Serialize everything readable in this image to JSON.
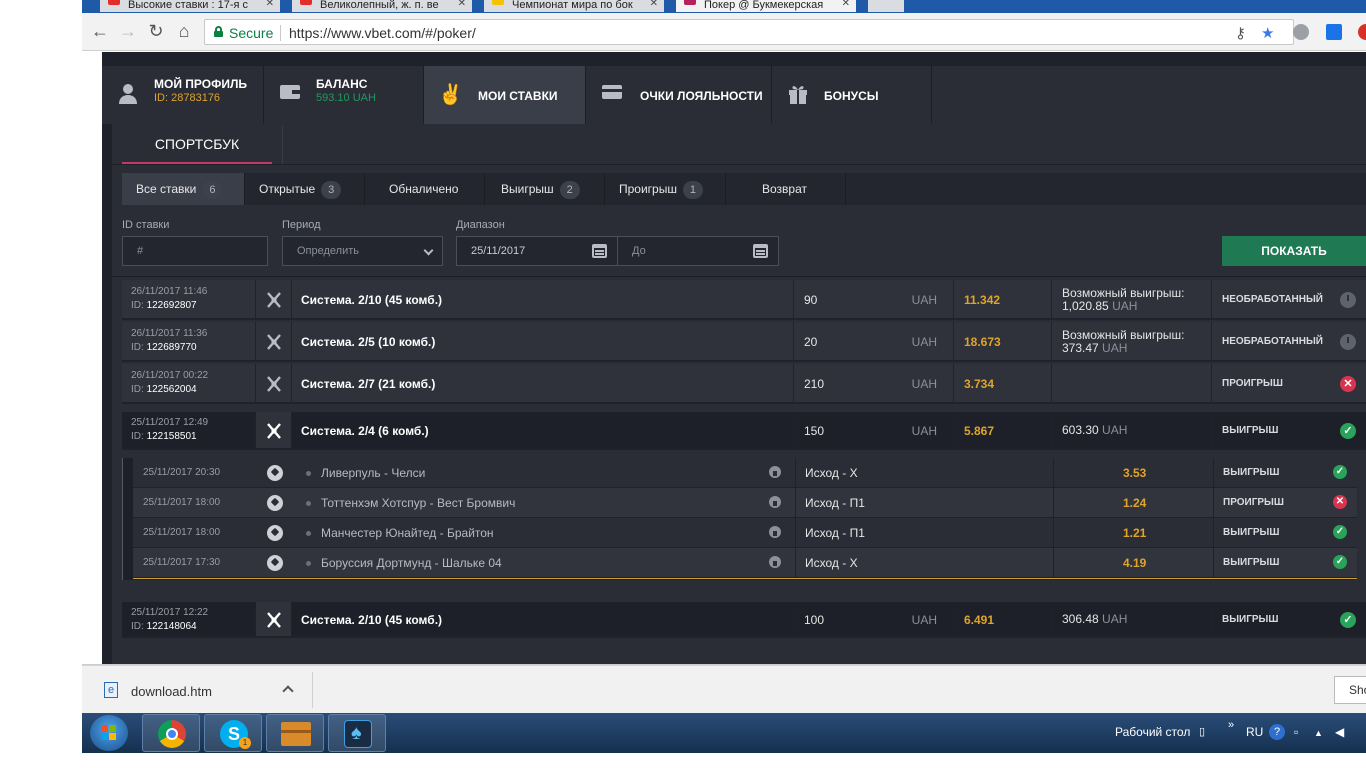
{
  "browser": {
    "tabs": [
      {
        "label": "Высокие ставки : 17-я с",
        "fav_color": "#e52d27"
      },
      {
        "label": "Великолепный, ж. п. ве",
        "fav_color": "#e52d27"
      },
      {
        "label": "Чемпионат мира по бок",
        "fav_color": "#f6c200"
      },
      {
        "label": "Покер @ Букмекерская",
        "fav_color": "#b8205b"
      }
    ],
    "secure_label": "Secure",
    "url": "https://www.vbet.com/#/poker/"
  },
  "account_nav": {
    "profile": {
      "title": "МОЙ ПРОФИЛЬ",
      "sub": "ID: 28783176",
      "sub_color": "#e0a42a"
    },
    "balance": {
      "title": "БАЛАНС",
      "sub": "593.10 UAH",
      "sub_color": "#1f9a5f"
    },
    "bets": {
      "title": "МОИ СТАВКИ"
    },
    "loyalty": {
      "title": "ОЧКИ ЛОЯЛЬНОСТИ"
    },
    "bonuses": {
      "title": "БОНУСЫ"
    }
  },
  "sportsbook_tab": "СПОРТСБУК",
  "filters": [
    {
      "label": "Все ставки",
      "count": "6"
    },
    {
      "label": "Открытые",
      "count": "3"
    },
    {
      "label": "Обналичено",
      "count": ""
    },
    {
      "label": "Выигрыш",
      "count": "2"
    },
    {
      "label": "Проигрыш",
      "count": "1"
    },
    {
      "label": "Возврат",
      "count": ""
    }
  ],
  "search": {
    "id_label": "ID ставки",
    "id_placeholder": "#",
    "period_label": "Период",
    "period_value": "Определить",
    "range_label": "Диапазон",
    "range_from": "25/11/2017",
    "range_to": "До",
    "show_button": "ПОКАЗАТЬ"
  },
  "bets": [
    {
      "date": "26/11/2017 11:46",
      "id": "122692807",
      "type": "Система. 2/10 (45 комб.)",
      "amount": "90",
      "currency": "UAH",
      "odds": "11.342",
      "win_label": "Возможный выигрыш:",
      "win_value": "1,020.85",
      "win_currency": "UAH",
      "status": "НЕОБРАБОТАННЫЙ"
    },
    {
      "date": "26/11/2017 11:36",
      "id": "122689770",
      "type": "Система. 2/5 (10 комб.)",
      "amount": "20",
      "currency": "UAH",
      "odds": "18.673",
      "win_label": "Возможный выигрыш:",
      "win_value": "373.47",
      "win_currency": "UAH",
      "status": "НЕОБРАБОТАННЫЙ"
    },
    {
      "date": "26/11/2017 00:22",
      "id": "122562004",
      "type": "Система. 2/7 (21 комб.)",
      "amount": "210",
      "currency": "UAH",
      "odds": "3.734",
      "win_label": "",
      "win_value": "",
      "win_currency": "",
      "status": "ПРОИГРЫШ"
    },
    {
      "date": "25/11/2017 12:49",
      "id": "122158501",
      "type": "Система. 2/4 (6 комб.)",
      "amount": "150",
      "currency": "UAH",
      "odds": "5.867",
      "win_label": "",
      "win_value": "603.30",
      "win_currency": "UAH",
      "status": "ВЫИГРЫШ"
    },
    {
      "date": "25/11/2017 12:22",
      "id": "122148064",
      "type": "Система. 2/10 (45 комб.)",
      "amount": "100",
      "currency": "UAH",
      "odds": "6.491",
      "win_label": "",
      "win_value": "306.48",
      "win_currency": "UAH",
      "status": "ВЫИГРЫШ"
    }
  ],
  "id_prefix": "ID:",
  "selections": [
    {
      "date": "25/11/2017 20:30",
      "match": "Ливерпуль - Челси",
      "outcome": "Исход - Х",
      "odds": "3.53",
      "status": "ВЫИГРЫШ"
    },
    {
      "date": "25/11/2017 18:00",
      "match": "Тоттенхэм Хотспур - Вест Бромвич",
      "outcome": "Исход - П1",
      "odds": "1.24",
      "status": "ПРОИГРЫШ"
    },
    {
      "date": "25/11/2017 18:00",
      "match": "Манчестер Юнайтед - Брайтон",
      "outcome": "Исход - П1",
      "odds": "1.21",
      "status": "ВЫИГРЫШ"
    },
    {
      "date": "25/11/2017 17:30",
      "match": "Боруссия Дортмунд - Шальке 04",
      "outcome": "Исход - Х",
      "odds": "4.19",
      "status": "ВЫИГРЫШ"
    }
  ],
  "download": {
    "file": "download.htm",
    "show_all": "Show all"
  },
  "taskbar": {
    "desktop_label": "Рабочий стол",
    "lang": "RU",
    "skype_badge": "1"
  }
}
